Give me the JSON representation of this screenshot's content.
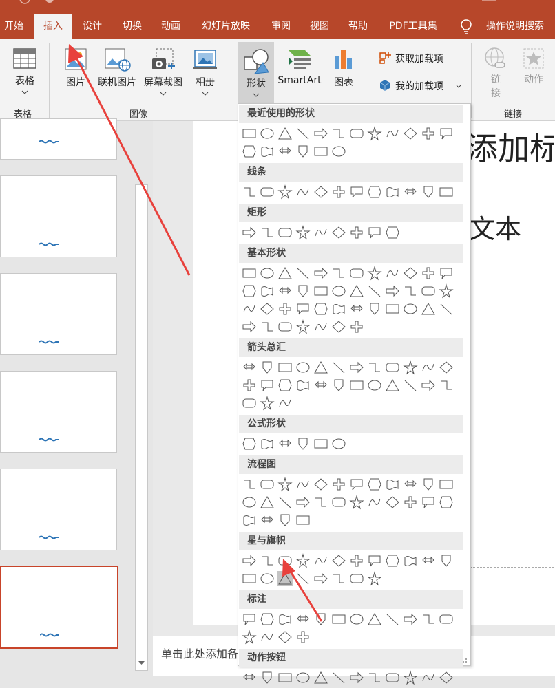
{
  "tabs": [
    "开始",
    "插入",
    "设计",
    "切换",
    "动画",
    "幻灯片放映",
    "审阅",
    "视图",
    "帮助",
    "PDF工具集"
  ],
  "active_tab": "插入",
  "tell_me": "操作说明搜索",
  "ribbon": {
    "table_group": {
      "button": "表格",
      "label": "表格"
    },
    "images_group": {
      "picture": "图片",
      "online_picture": "联机图片",
      "screenshot": "屏幕截图",
      "album": "相册",
      "label": "图像"
    },
    "illustrations": {
      "shapes": "形状",
      "smartart": "SmartArt",
      "chart": "图表"
    },
    "addins": {
      "get": "获取加载项",
      "my": "我的加载项"
    },
    "links_group": {
      "link_line1": "链",
      "link_line2": "接",
      "action": "动作",
      "label": "链接"
    }
  },
  "slide_title_partial": "添加标",
  "slide_body_partial": "文本",
  "notes_placeholder": "单击此处添加备",
  "shape_sections": [
    "最近使用的形状",
    "线条",
    "矩形",
    "基本形状",
    "箭头总汇",
    "公式形状",
    "流程图",
    "星与旗帜",
    "标注",
    "动作按钮"
  ],
  "shape_counts": [
    [
      12,
      6
    ],
    [
      12
    ],
    [
      9
    ],
    [
      12,
      12,
      12,
      7
    ],
    [
      12,
      12,
      3
    ],
    [
      6
    ],
    [
      12,
      12,
      4
    ],
    [
      12,
      8
    ],
    [
      12,
      4
    ],
    [
      12
    ]
  ],
  "highlighted_shape": {
    "section": 7,
    "index": 14
  },
  "colors": {
    "accent": "#b7472a",
    "selection_border": "#c8442a",
    "arrow": "#e8413c"
  }
}
